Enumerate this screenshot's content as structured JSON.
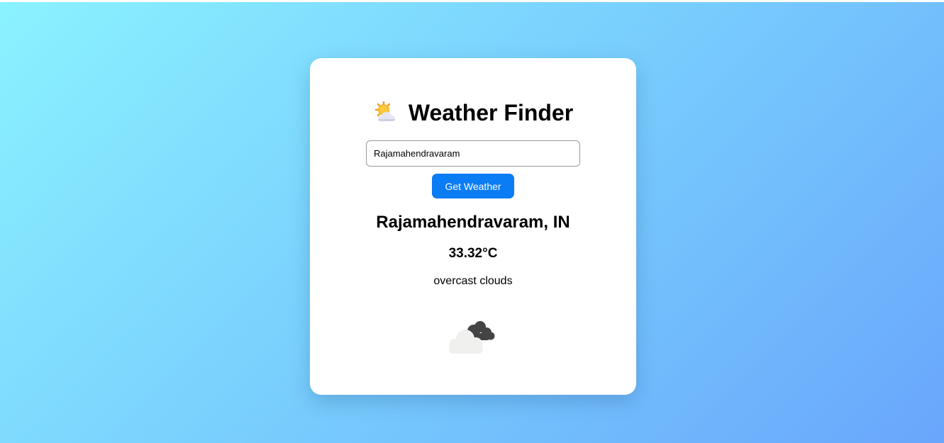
{
  "app": {
    "title": "Weather Finder",
    "title_icon": "sun-behind-cloud-icon"
  },
  "search": {
    "value": "Rajamahendravaram",
    "button_label": "Get Weather"
  },
  "result": {
    "location": "Rajamahendravaram, IN",
    "temperature": "33.32°C",
    "description": "overcast clouds",
    "icon": "overcast-clouds-icon"
  },
  "colors": {
    "button": "#0a7cf4",
    "card": "#ffffff",
    "background_start": "#8bf2ff",
    "background_end": "#69a6fc"
  }
}
